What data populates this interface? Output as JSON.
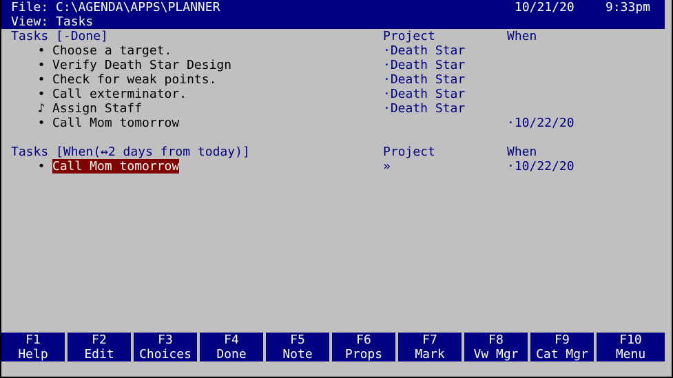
{
  "header": {
    "file": "File: C:\\AGENDA\\APPS\\PLANNER",
    "date": "10/21/20",
    "time": "9:33pm",
    "view": "View: Tasks"
  },
  "section1": {
    "title": "Tasks [-Done]",
    "project_header": "Project",
    "when_header": "When",
    "rows": [
      {
        "marker": "•",
        "task": "Choose a target.",
        "project": "·Death Star",
        "when": ""
      },
      {
        "marker": "•",
        "task": "Verify Death Star Design",
        "project": "·Death Star",
        "when": ""
      },
      {
        "marker": "•",
        "task": "Check for weak points.",
        "project": "·Death Star",
        "when": ""
      },
      {
        "marker": "•",
        "task": "Call exterminator.",
        "project": "·Death Star",
        "when": ""
      },
      {
        "marker": "♪",
        "task": "Assign Staff",
        "project": "·Death Star",
        "when": ""
      },
      {
        "marker": "•",
        "task": "Call Mom tomorrow",
        "project": "",
        "when": "·10/22/20"
      }
    ]
  },
  "section2": {
    "title": "Tasks [When(↔2 days from today)]",
    "project_header": "Project",
    "when_header": "When",
    "rows": [
      {
        "marker": "•",
        "task": "Call Mom tomorrow",
        "project": "»",
        "when": "·10/22/20",
        "selected": true
      }
    ]
  },
  "function_keys": [
    {
      "key": "F1",
      "label": "Help"
    },
    {
      "key": "F2",
      "label": "Edit"
    },
    {
      "key": "F3",
      "label": "Choices"
    },
    {
      "key": "F4",
      "label": "Done"
    },
    {
      "key": "F5",
      "label": "Note"
    },
    {
      "key": "F6",
      "label": "Props"
    },
    {
      "key": "F7",
      "label": "Mark"
    },
    {
      "key": "F8",
      "label": "Vw Mgr"
    },
    {
      "key": "F9",
      "label": "Cat Mgr"
    },
    {
      "key": "F10",
      "label": "Menu"
    }
  ],
  "colors": {
    "screen_bg": "#c0c0c0",
    "header_bg": "#000080",
    "text_blue": "#000080",
    "selection_bg": "#800000"
  }
}
